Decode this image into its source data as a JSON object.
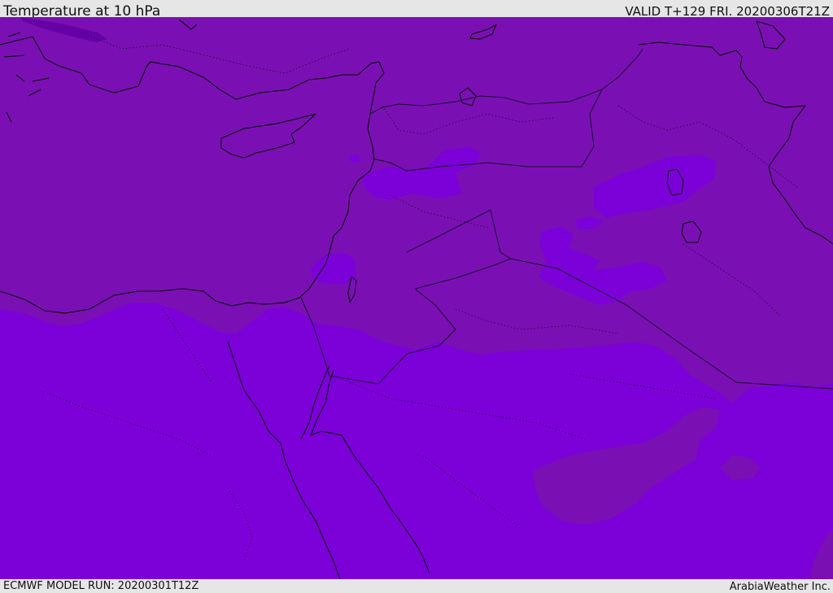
{
  "header": {
    "title": "Temperature at 10 hPa",
    "valid_time": "VALID T+129 FRI. 20200306T21Z"
  },
  "footer": {
    "model_run": "ECMWF MODEL RUN: 20200301T12Z",
    "brand": "ArabiaWeather Inc."
  },
  "map": {
    "colors": {
      "zone_dark": "#7a10b4",
      "zone_light": "#7c00d8",
      "zone_deep": "#6500a6",
      "coast": "#000000",
      "border": "#1a0a30",
      "header_bg": "#e6e6e6"
    }
  }
}
